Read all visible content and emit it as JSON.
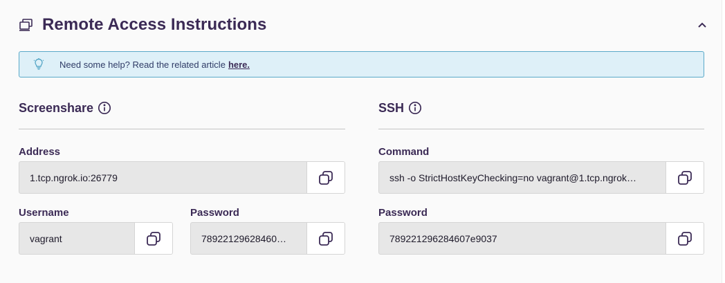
{
  "header": {
    "title": "Remote Access Instructions",
    "title_icon": "computer-icon",
    "collapse_icon": "chevron-up-icon"
  },
  "help": {
    "icon": "lightbulb-icon",
    "text": "Need some help? Read the related article",
    "link_label": "here."
  },
  "screenshare": {
    "title": "Screenshare",
    "info_icon": "info-icon",
    "address_label": "Address",
    "address_value": "1.tcp.ngrok.io:26779",
    "username_label": "Username",
    "username_value": "vagrant",
    "password_label": "Password",
    "password_value": "78922129628460…"
  },
  "ssh": {
    "title": "SSH",
    "info_icon": "info-icon",
    "command_label": "Command",
    "command_value": "ssh -o StrictHostKeyChecking=no vagrant@1.tcp.ngrok…",
    "password_label": "Password",
    "password_value": "789221296284607e9037"
  },
  "copy_icon": "copy-icon",
  "colors": {
    "heading": "#3b2a55",
    "banner_bg": "#def0f8",
    "banner_border": "#5aa9c9",
    "field_bg": "#e7e7e7"
  }
}
